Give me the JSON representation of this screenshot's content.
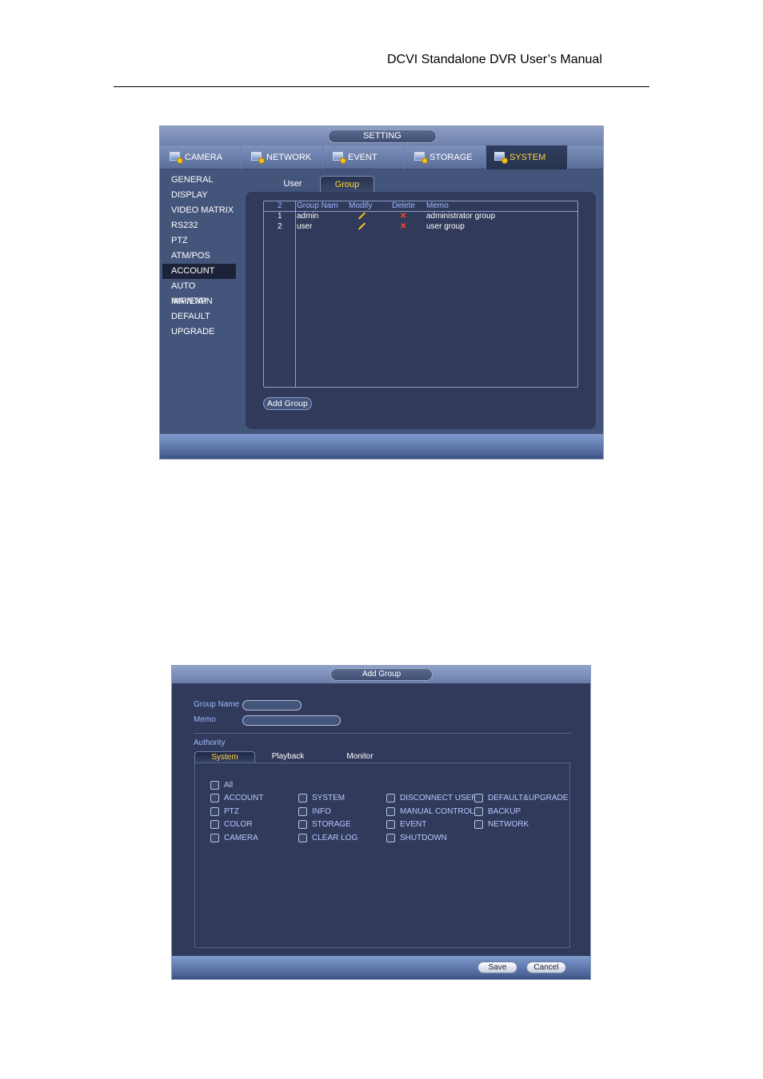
{
  "document": {
    "header": "DCVI Standalone DVR User’s Manual"
  },
  "setting_screen": {
    "title": "SETTING",
    "top_tabs": [
      {
        "label": "CAMERA",
        "icon": "camera-icon",
        "active": false
      },
      {
        "label": "NETWORK",
        "icon": "network-icon",
        "active": false
      },
      {
        "label": "EVENT",
        "icon": "event-icon",
        "active": false
      },
      {
        "label": "STORAGE",
        "icon": "storage-icon",
        "active": false
      },
      {
        "label": "SYSTEM",
        "icon": "system-icon",
        "active": true
      }
    ],
    "sidebar": [
      {
        "label": "GENERAL"
      },
      {
        "label": "DISPLAY"
      },
      {
        "label": "VIDEO MATRIX"
      },
      {
        "label": "RS232"
      },
      {
        "label": "PTZ"
      },
      {
        "label": "ATM/POS"
      },
      {
        "label": "ACCOUNT",
        "active": true
      },
      {
        "label": "AUTO MAINTAIN"
      },
      {
        "label": "IMP/EXP"
      },
      {
        "label": "DEFAULT"
      },
      {
        "label": "UPGRADE"
      }
    ],
    "sub_tabs": [
      {
        "label": "User",
        "active": false
      },
      {
        "label": "Group",
        "active": true
      }
    ],
    "table": {
      "headers": {
        "count": "2",
        "group_name": "Group Nam",
        "modify": "Modify",
        "delete": "Delete",
        "memo": "Memo"
      },
      "rows": [
        {
          "index": "1",
          "group_name": "admin",
          "memo": "administrator group"
        },
        {
          "index": "2",
          "group_name": "user",
          "memo": "user group"
        }
      ]
    },
    "add_group_button": "Add Group"
  },
  "add_group_dialog": {
    "title": "Add Group",
    "group_name_label": "Group Name",
    "group_name_value": "",
    "memo_label": "Memo",
    "memo_value": "",
    "authority_label": "Authority",
    "tabs": [
      {
        "label": "System",
        "active": true
      },
      {
        "label": "Playback",
        "active": false
      },
      {
        "label": "Monitor",
        "active": false
      }
    ],
    "all_label": "All",
    "permissions": [
      [
        "ACCOUNT",
        "SYSTEM",
        "DISCONNECT USER",
        "DEFAULT&UPGRADE"
      ],
      [
        "PTZ",
        "INFO",
        "MANUAL CONTROL",
        "BACKUP"
      ],
      [
        "COLOR",
        "STORAGE",
        "EVENT",
        "NETWORK"
      ],
      [
        "CAMERA",
        "CLEAR LOG",
        "SHUTDOWN"
      ]
    ],
    "save_button": "Save",
    "cancel_button": "Cancel"
  },
  "colors": {
    "panel_bg": "#313a5a",
    "frame_bg": "#44557c",
    "accent_yellow": "#ffd43a",
    "header_blue": "#9eb8ff",
    "delete_red": "#ff4a2a"
  }
}
